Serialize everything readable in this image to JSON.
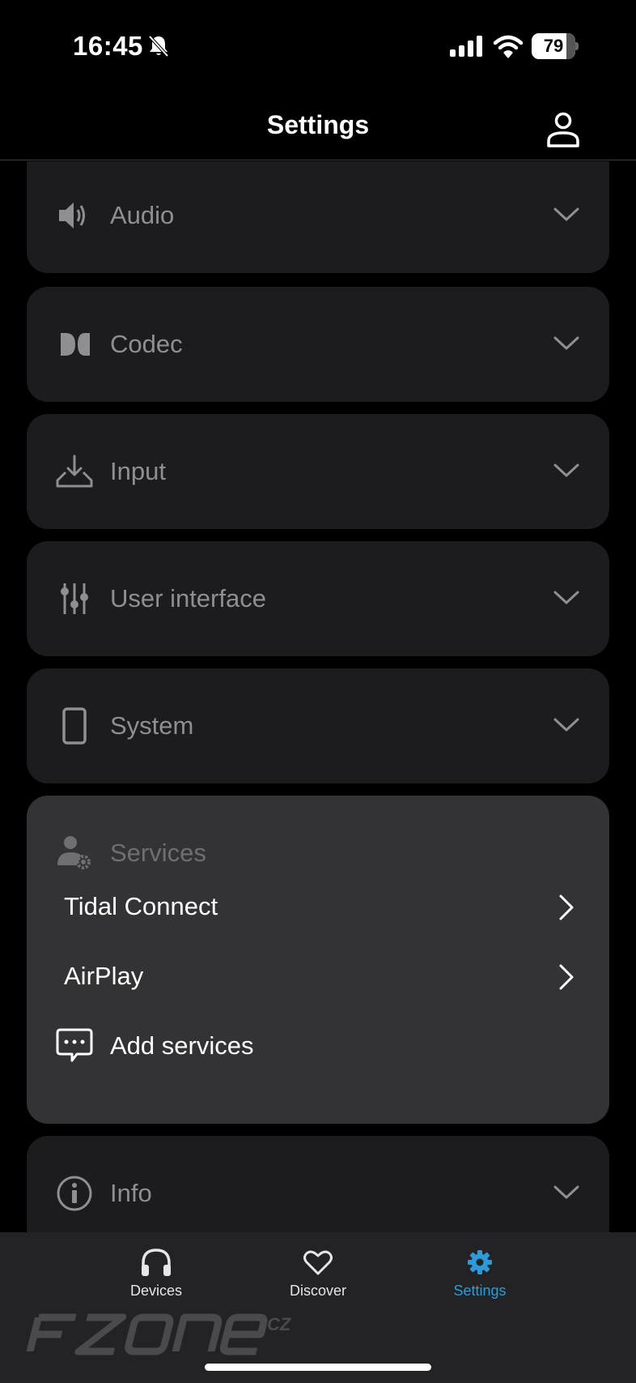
{
  "status_bar": {
    "time": "16:45",
    "battery_percent": "79",
    "battery_level": 0.79,
    "icons": [
      "bell-slash-icon",
      "cellular-signal-icon",
      "wifi-icon",
      "battery-icon"
    ]
  },
  "header": {
    "title": "Settings",
    "profile_icon": "user-profile-icon"
  },
  "sections": [
    {
      "label": "Audio",
      "icon": "speaker-icon",
      "state": "collapsed"
    },
    {
      "label": "Codec",
      "icon": "dolby-icon",
      "state": "collapsed"
    },
    {
      "label": "Input",
      "icon": "input-tray-icon",
      "state": "collapsed"
    },
    {
      "label": "User interface",
      "icon": "sliders-icon",
      "state": "collapsed"
    },
    {
      "label": "System",
      "icon": "phone-device-icon",
      "state": "collapsed"
    },
    {
      "label": "Services",
      "icon": "user-gear-icon",
      "state": "expanded"
    },
    {
      "label": "Info",
      "icon": "info-circle-icon",
      "state": "collapsed"
    }
  ],
  "services": {
    "items": [
      {
        "label": "Tidal Connect",
        "icon": "chevron-right-icon"
      },
      {
        "label": "AirPlay",
        "icon": "chevron-right-icon"
      },
      {
        "label": "Add services",
        "icon": "chat-bubble-icon"
      }
    ]
  },
  "tab_bar": {
    "tabs": [
      {
        "label": "Devices",
        "icon": "headphones-icon"
      },
      {
        "label": "Discover",
        "icon": "heart-icon"
      },
      {
        "label": "Settings",
        "icon": "gear-icon",
        "active": true
      }
    ],
    "active_color": "#2e9bd8"
  },
  "watermark": {
    "text": "FZONE",
    "suffix": "CZ"
  },
  "colors": {
    "background": "#000000",
    "card": "#1c1c1e",
    "card_expanded": "#333335",
    "muted_text": "#8e8e93",
    "accent": "#2e9bd8"
  }
}
